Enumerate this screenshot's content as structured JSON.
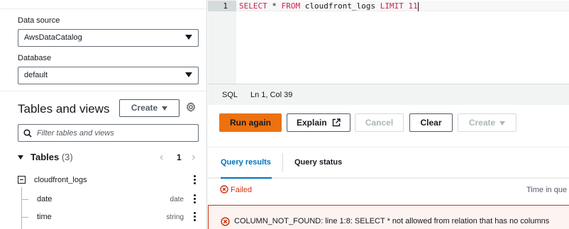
{
  "left_panel": {
    "data_source_label": "Data source",
    "data_source_value": "AwsDataCatalog",
    "database_label": "Database",
    "database_value": "default",
    "tables_views_title": "Tables and views",
    "create_label": "Create",
    "filter_placeholder": "Filter tables and views",
    "tables_label": "Tables",
    "tables_count": "(3)",
    "page_number": "1",
    "tree": [
      {
        "name": "cloudfront_logs",
        "type": ""
      },
      {
        "name": "date",
        "type": "date"
      },
      {
        "name": "time",
        "type": "string"
      }
    ]
  },
  "editor": {
    "line_number": "1",
    "code_keyword_1": "SELECT",
    "code_text_1": " * ",
    "code_keyword_2": "FROM",
    "code_text_2": " cloudfront_logs ",
    "code_keyword_3": "LIMIT",
    "code_text_3": " 11"
  },
  "status_bar": {
    "language": "SQL",
    "position": "Ln 1, Col 39"
  },
  "toolbar": {
    "run_again": "Run again",
    "explain": "Explain",
    "cancel": "Cancel",
    "clear": "Clear",
    "create": "Create"
  },
  "results": {
    "tabs": [
      "Query results",
      "Query status"
    ],
    "status": "Failed",
    "time_label": "Time in que",
    "error_message": "COLUMN_NOT_FOUND: line 1:8: SELECT * not allowed from relation that has no columns"
  },
  "colors": {
    "primary_button": "#ec7211",
    "active_tab": "#0073bb",
    "error": "#d13212",
    "sql_keyword": "#c7254e"
  }
}
